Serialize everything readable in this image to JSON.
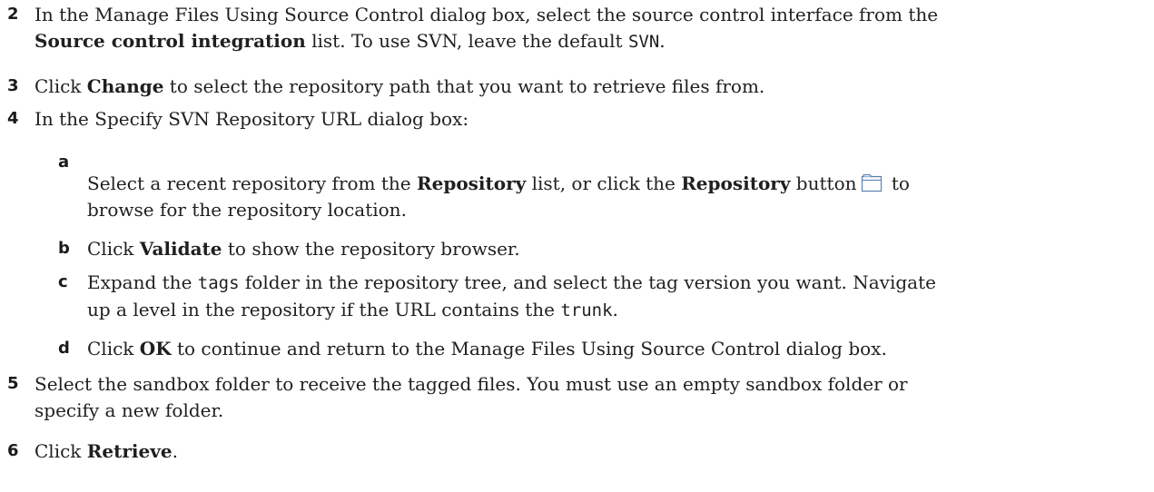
{
  "steps": [
    {
      "num": "2",
      "l1": "In the Manage Files Using Source Control dialog box, select the source control interface from the",
      "l2_bold": "Source control integration",
      "l2_mid": " list. To use SVN, leave the default ",
      "l2_code": "SVN",
      "l2_end": "."
    },
    {
      "num": "3",
      "pre": "Click ",
      "bold": "Change",
      "post": " to select the repository path that you want to retrieve files from."
    },
    {
      "num": "4",
      "text": "In the Specify SVN Repository URL dialog box:"
    },
    {
      "num": "5",
      "l1": "Select the sandbox folder to receive the tagged files. You must use an empty sandbox folder or",
      "l2": "specify a new folder."
    },
    {
      "num": "6",
      "pre": "Click ",
      "bold": "Retrieve",
      "post": "."
    }
  ],
  "substeps": [
    {
      "num": "a",
      "l1_pre": "Select a recent repository from the ",
      "l1_bold": "Repository",
      "l1_mid": " list, or click the ",
      "l1_bold2": "Repository",
      "l1_post": " button",
      "l1_end": " to",
      "l2": "browse for the repository location.",
      "icon": "folder-icon"
    },
    {
      "num": "b",
      "pre": "Click ",
      "bold": "Validate",
      "post": " to show the repository browser."
    },
    {
      "num": "c",
      "l1_pre": "Expand the ",
      "l1_code": "tags",
      "l1_post": " folder in the repository tree, and select the tag version you want. Navigate",
      "l2_pre": "up a level in the repository if the URL contains the ",
      "l2_code": "trunk",
      "l2_post": "."
    },
    {
      "num": "d",
      "pre": "Click ",
      "bold": "OK",
      "post": " to continue and return to the Manage Files Using Source Control dialog box."
    }
  ]
}
